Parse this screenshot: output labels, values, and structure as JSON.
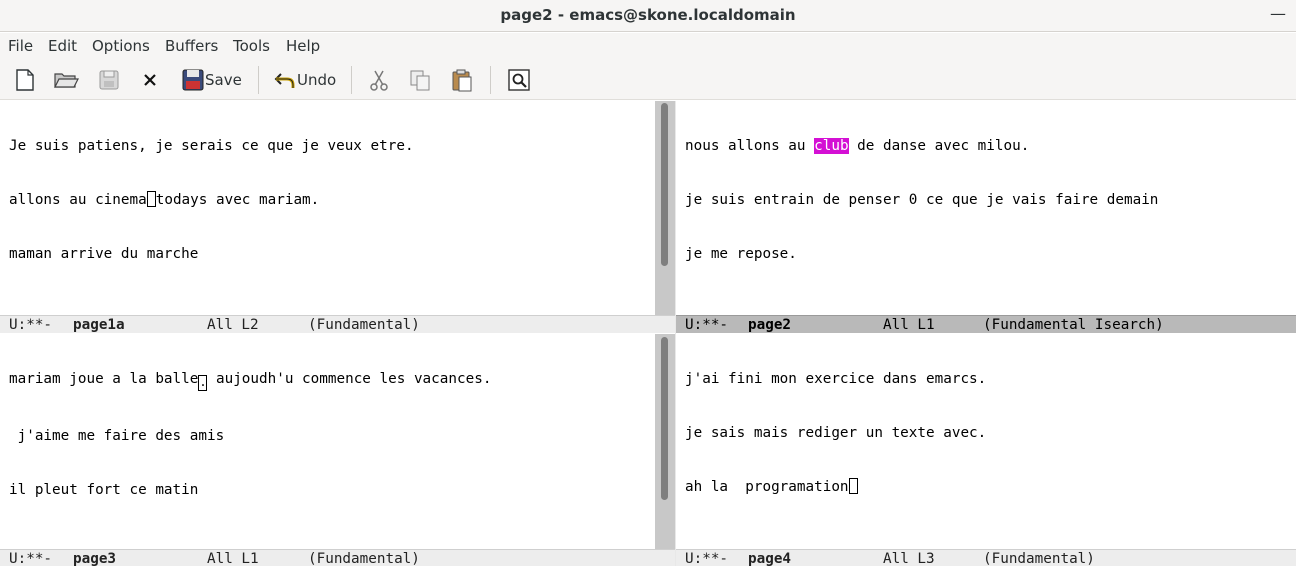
{
  "window": {
    "title": "page2 - emacs@skone.localdomain",
    "minimize_glyph": "—"
  },
  "menubar": {
    "items": [
      "File",
      "Edit",
      "Options",
      "Buffers",
      "Tools",
      "Help"
    ]
  },
  "toolbar": {
    "save_label": "Save",
    "undo_label": "Undo",
    "icons": [
      "new-file-icon",
      "open-folder-icon",
      "disk-icon",
      "close-icon",
      "save-icon",
      "undo-icon",
      "cut-icon",
      "copy-icon",
      "paste-icon",
      "search-icon"
    ]
  },
  "panes": {
    "top_left": {
      "lines": [
        "Je suis patiens, je serais ce que je veux etre.",
        "allons au cinema",
        "todays avec mariam.",
        "maman arrive du marche"
      ],
      "modeline": {
        "status": "U:**-",
        "buffer": "page1a",
        "position": "All L2",
        "mode": "(Fundamental)"
      }
    },
    "top_right": {
      "lines": [
        "nous allons au ",
        "club",
        " de danse avec milou.",
        "je suis entrain de penser 0 ce que je vais faire demain",
        "je me repose."
      ],
      "modeline": {
        "status": "U:**-",
        "buffer": "page2",
        "position": "All L1",
        "mode": "(Fundamental Isearch)"
      }
    },
    "bottom_left": {
      "lines": [
        "mariam joue a la balle",
        ".",
        " aujoudh'u commence les vacances.",
        " j'aime me faire des amis",
        "il pleut fort ce matin"
      ],
      "modeline": {
        "status": "U:**-",
        "buffer": "page3",
        "position": "All L1",
        "mode": "(Fundamental)"
      }
    },
    "bottom_right": {
      "lines": [
        "j'ai fini mon exercice dans emarcs.",
        "je sais mais rediger un texte avec.",
        "ah la  programation"
      ],
      "modeline": {
        "status": "U:**-",
        "buffer": "page4",
        "position": "All L3",
        "mode": "(Fundamental)"
      }
    }
  },
  "colors": {
    "isearch_highlight": "#d410d4",
    "active_modeline": "#b9b9b9",
    "inactive_modeline": "#ededed"
  }
}
